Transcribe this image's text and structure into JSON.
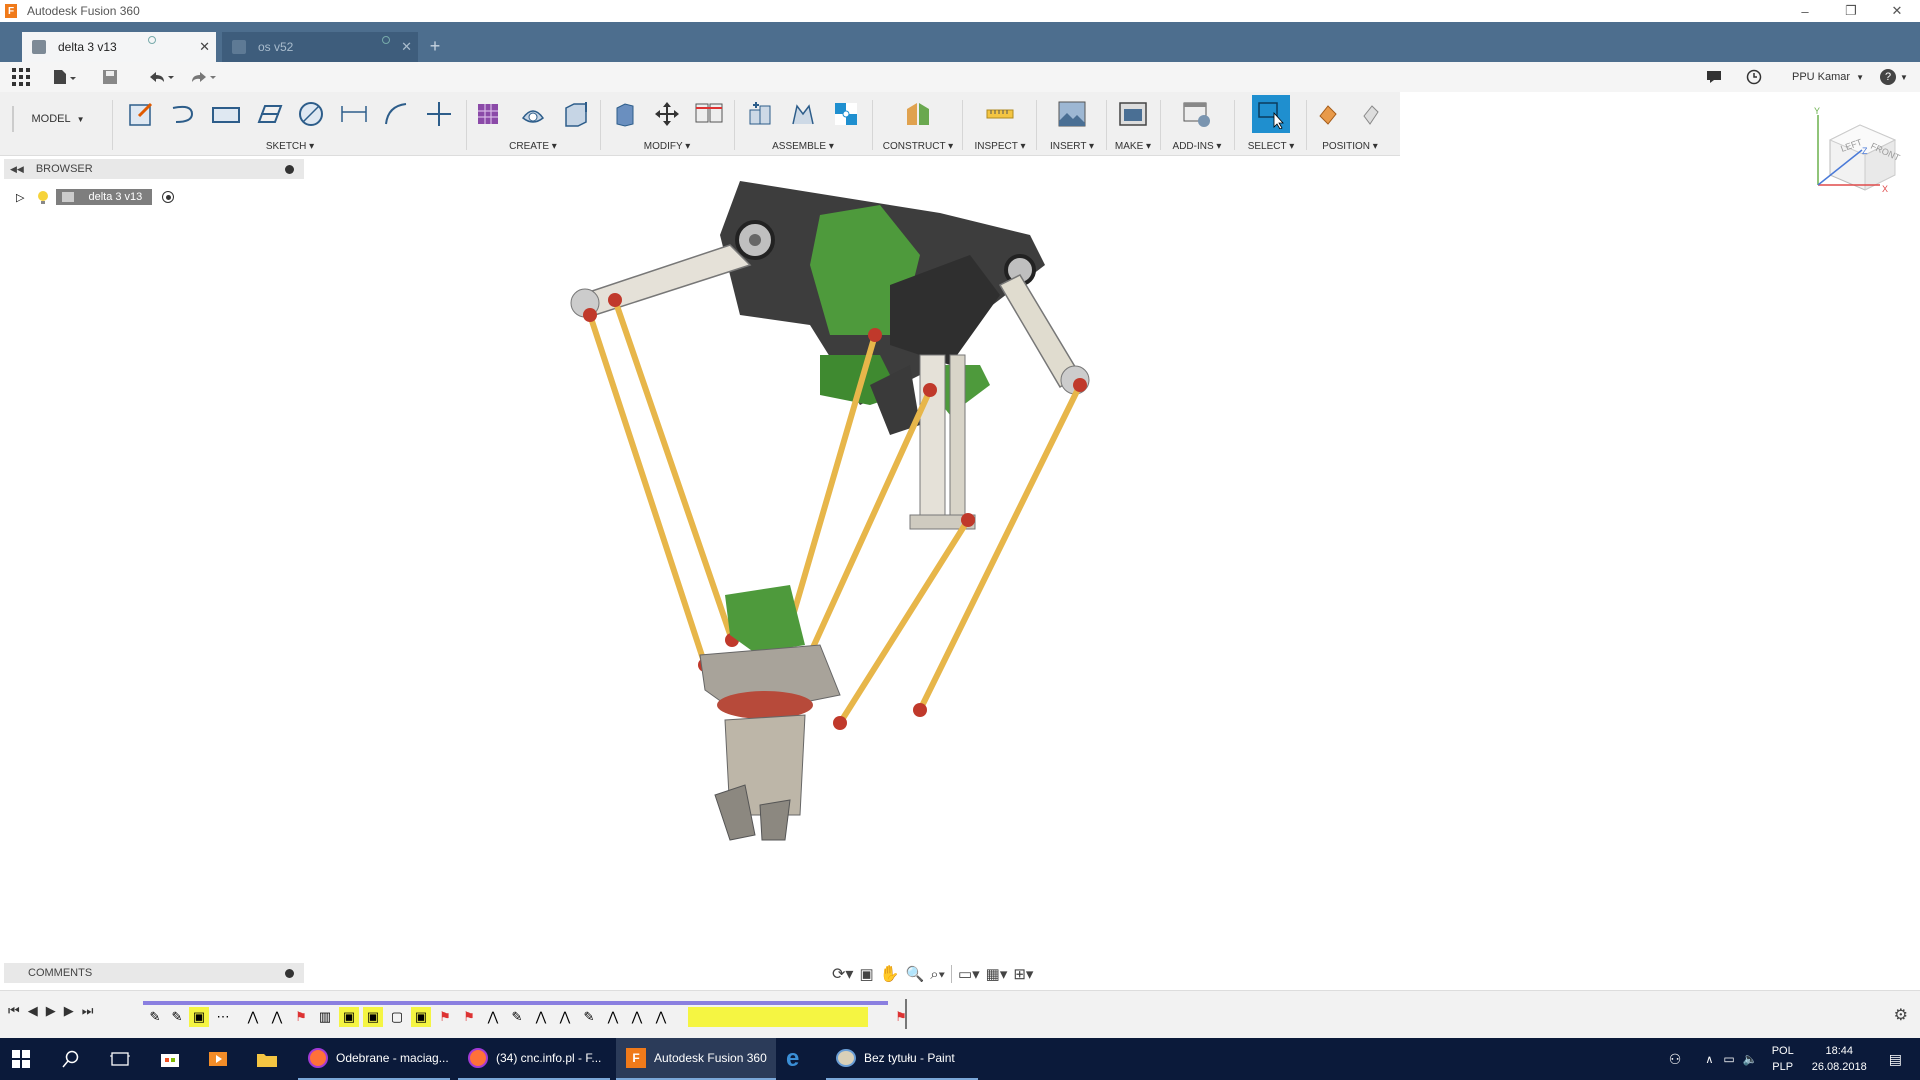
{
  "window": {
    "title": "Autodesk Fusion 360",
    "logo_letter": "F",
    "controls": [
      "–",
      "❐",
      "✕"
    ]
  },
  "tabs": [
    {
      "label": "delta 3 v13",
      "active": true
    },
    {
      "label": "os v52",
      "active": false
    }
  ],
  "new_tab_glyph": "+",
  "qa": {
    "user": "PPU Kamar",
    "help": "?"
  },
  "toolbar": {
    "workspace": "MODEL",
    "groups": [
      "SKETCH",
      "CREATE",
      "MODIFY",
      "ASSEMBLE",
      "CONSTRUCT",
      "INSPECT",
      "INSERT",
      "MAKE",
      "ADD-INS",
      "SELECT",
      "POSITION"
    ]
  },
  "browser": {
    "header": "BROWSER",
    "root_label": "delta 3 v13"
  },
  "comments": {
    "header": "COMMENTS"
  },
  "viewcube": {
    "left": "LEFT",
    "front": "FRONT",
    "axis_x": "X",
    "axis_y": "Y",
    "axis_z": "Z"
  },
  "taskbar": {
    "apps": [
      {
        "label": "Odebrane - maciag...",
        "icon": "firefox-icon"
      },
      {
        "label": "(34) cnc.info.pl - F...",
        "icon": "firefox-icon"
      },
      {
        "label": "Autodesk Fusion 360",
        "icon": "fusion-icon",
        "active": true
      },
      {
        "label": "Bez tytułu - Paint",
        "icon": "paint-icon"
      }
    ],
    "lang_top": "POL",
    "lang_bottom": "PLP",
    "time": "18:44",
    "date": "26.08.2018"
  },
  "colors": {
    "tabstrip": "#4d6e8e",
    "select_active": "#1f8fcf",
    "taskbar": "#0b1a3a",
    "rod_yellow": "#e7b64a",
    "motor_green": "#4e9a3c"
  }
}
